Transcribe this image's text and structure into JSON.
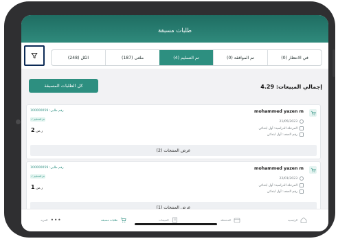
{
  "header": {
    "title": "طلبات مسبقة"
  },
  "filter": {
    "icon": "filter-icon"
  },
  "tabs": [
    {
      "label": "الكل (248)",
      "active": false
    },
    {
      "label": "ملغى (187)",
      "active": false
    },
    {
      "label": "تم التسليم (4)",
      "active": true
    },
    {
      "label": "تم الموافقة (0)",
      "active": false
    },
    {
      "label": "في الانتظار (0)",
      "active": false
    }
  ],
  "summary": {
    "all_button": "كل الطلبات المسبقة",
    "total": "إجمالي المبيعات: 4.29"
  },
  "orders": [
    {
      "name": "mohammed yazen m",
      "date": "21/05/2023",
      "stage": "المرحلة الدراسية: أول ابتدائي",
      "class": "رقم الصف: أول ابتدائي",
      "order_no": "رقم طلبي: 100000059",
      "badge": "✓ تم التسليم",
      "currency": "ر.س",
      "amount": "2",
      "view_products": "عرض المنتجات (2)"
    },
    {
      "name": "mohammed yazen m",
      "date": "22/01/2023",
      "stage": "المرحلة الدراسية: أول ابتدائي",
      "class": "رقم الصف: أول ابتدائي",
      "order_no": "رقم طلبي: 100000059",
      "badge": "✓ تم التسليم",
      "currency": "ر.س",
      "amount": "1",
      "view_products": "عرض المنتجات (1)"
    }
  ],
  "nav": {
    "more": "المزيد",
    "preorders": "طلبات مسبقة",
    "purchases": "المبيعات",
    "wallet": "المحفظة",
    "home": "الرئيسية"
  },
  "colors": {
    "brand": "#2d8f80",
    "header": "#1f6d62",
    "focus": "#0b2a55"
  }
}
